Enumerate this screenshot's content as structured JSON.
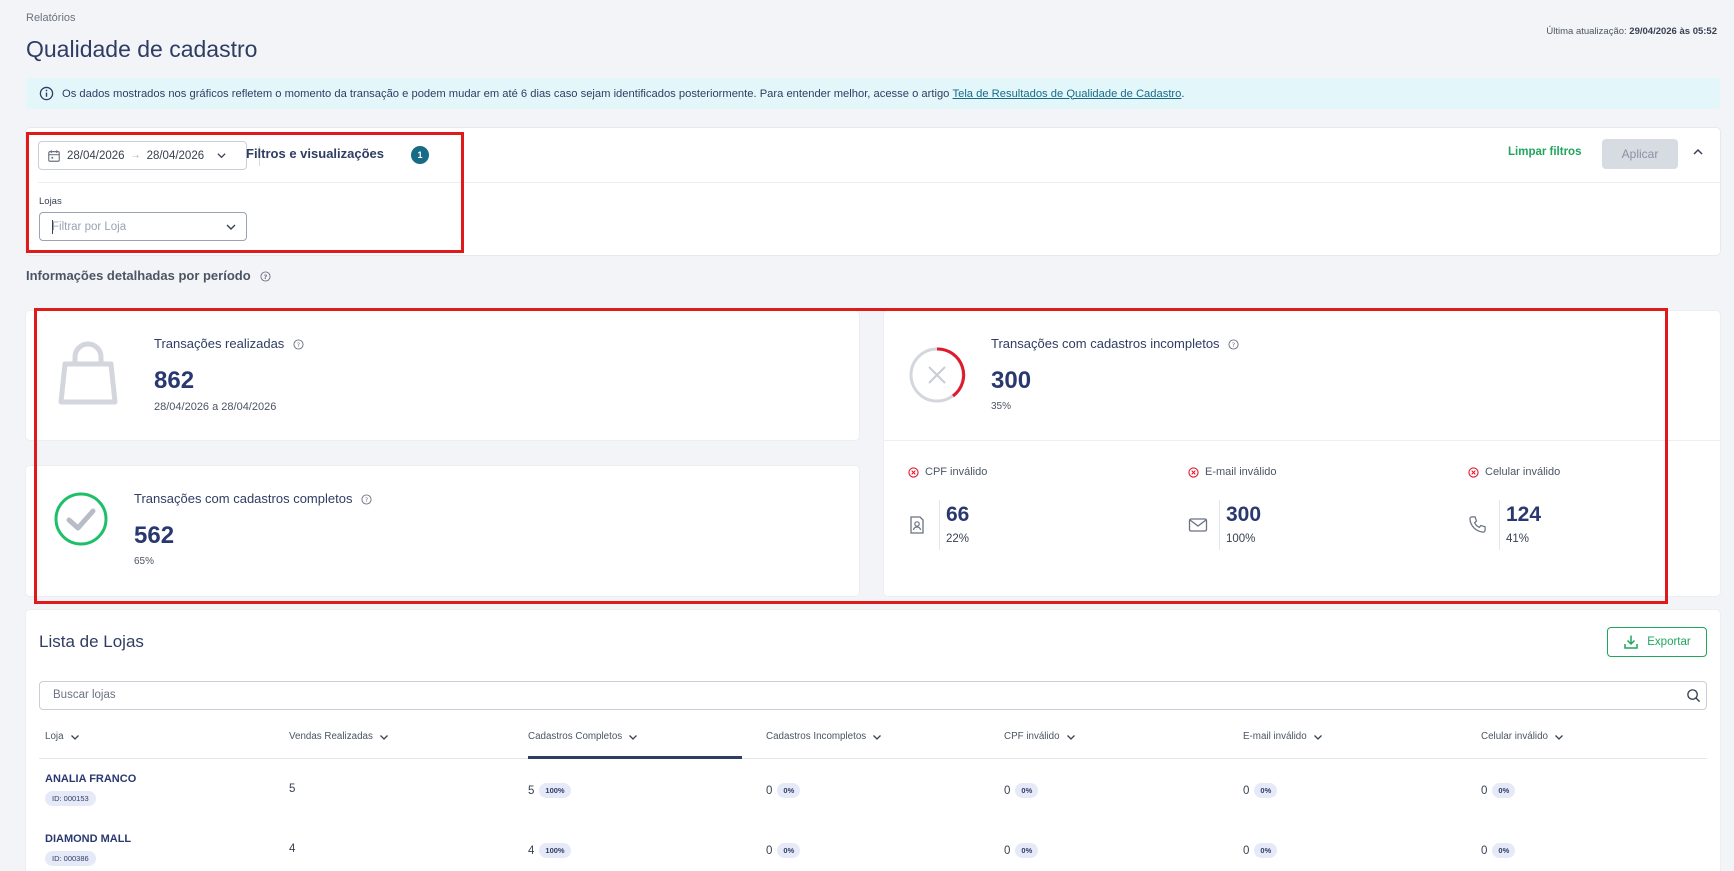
{
  "breadcrumb": "Relatórios",
  "page_title": "Qualidade de cadastro",
  "last_update": {
    "label": "Última atualização:",
    "value": "29/04/2026 às 05:52"
  },
  "info_banner": {
    "text": "Os dados mostrados nos gráficos refletem o momento da transação e podem mudar em até 6 dias caso sejam identificados posteriormente. Para entender melhor, acesse o artigo ",
    "link": "Tela de Resultados de Qualidade de Cadastro",
    "suffix": "."
  },
  "filters": {
    "date_start": "28/04/2026",
    "date_end": "28/04/2026",
    "title": "Filtros e visualizações",
    "badge": "1",
    "clear_label": "Limpar filtros",
    "apply_label": "Aplicar",
    "stores_label": "Lojas",
    "stores_placeholder": "Filtrar por Loja"
  },
  "section_title": "Informações detalhadas por período",
  "metrics": {
    "transactions": {
      "title": "Transações realizadas",
      "value": "862",
      "sub": "28/04/2026 a 28/04/2026"
    },
    "complete": {
      "title": "Transações com cadastros completos",
      "value": "562",
      "sub": "65%"
    },
    "incomplete": {
      "title": "Transações com cadastros incompletos",
      "value": "300",
      "sub": "35%"
    },
    "details": [
      {
        "label": "CPF inválido",
        "value": "66",
        "pct": "22%",
        "icon": "id-card-icon"
      },
      {
        "label": "E-mail inválido",
        "value": "300",
        "pct": "100%",
        "icon": "mail-icon"
      },
      {
        "label": "Celular inválido",
        "value": "124",
        "pct": "41%",
        "icon": "phone-icon"
      }
    ]
  },
  "list": {
    "title": "Lista de Lojas",
    "export_label": "Exportar",
    "search_placeholder": "Buscar lojas",
    "columns": [
      "Loja",
      "Vendas Realizadas",
      "Cadastros Completos",
      "Cadastros Incompletos",
      "CPF inválido",
      "E-mail inválido",
      "Celular inválido"
    ],
    "rows": [
      {
        "name": "ANALIA FRANCO",
        "id": "ID: 000153",
        "sales": "5",
        "complete": "5",
        "complete_pct": "100%",
        "incomplete": "0",
        "incomplete_pct": "0%",
        "cpf": "0",
        "cpf_pct": "0%",
        "email": "0",
        "email_pct": "0%",
        "phone": "0",
        "phone_pct": "0%"
      },
      {
        "name": "DIAMOND MALL",
        "id": "ID: 000386",
        "sales": "4",
        "complete": "4",
        "complete_pct": "100%",
        "incomplete": "0",
        "incomplete_pct": "0%",
        "cpf": "0",
        "cpf_pct": "0%",
        "email": "0",
        "email_pct": "0%",
        "phone": "0",
        "phone_pct": "0%"
      }
    ]
  },
  "colors": {
    "accent": "#176b87",
    "success": "#1fa65c",
    "danger": "#e01a1a",
    "title": "#2a3870"
  }
}
